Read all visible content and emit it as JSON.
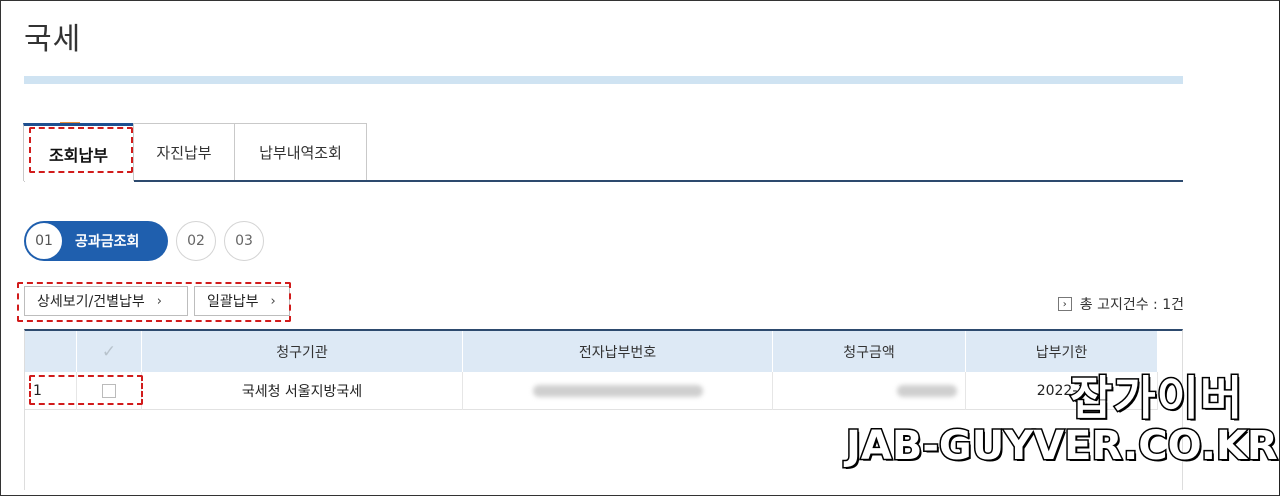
{
  "page": {
    "title": "국세"
  },
  "tabs": [
    {
      "label": "조회납부"
    },
    {
      "label": "자진납부"
    },
    {
      "label": "납부내역조회"
    }
  ],
  "steps": [
    {
      "num": "01",
      "label": "공과금조회"
    },
    {
      "num": "02"
    },
    {
      "num": "03"
    }
  ],
  "actions": {
    "detail_label": "상세보기/건별납부",
    "bulk_label": "일괄납부",
    "chevron": "›"
  },
  "total": {
    "arrow": "›",
    "text": "총 고지건수 : 1건"
  },
  "table": {
    "check_header": "✓",
    "headers": [
      "청구기관",
      "전자납부번호",
      "청구금액",
      "납부기한"
    ],
    "rows": [
      {
        "no": "1",
        "agency": "국세청 서울지방국세",
        "due": "2022-1"
      }
    ]
  },
  "watermark": {
    "korean": "잡가이버",
    "domain": "JAB-GUYVER.CO.KR"
  },
  "colors": {
    "accent": "#1f5fae",
    "tab_border": "#2d4a6e",
    "header_bg": "#dde9f5",
    "highlight": "#d11b1b"
  }
}
